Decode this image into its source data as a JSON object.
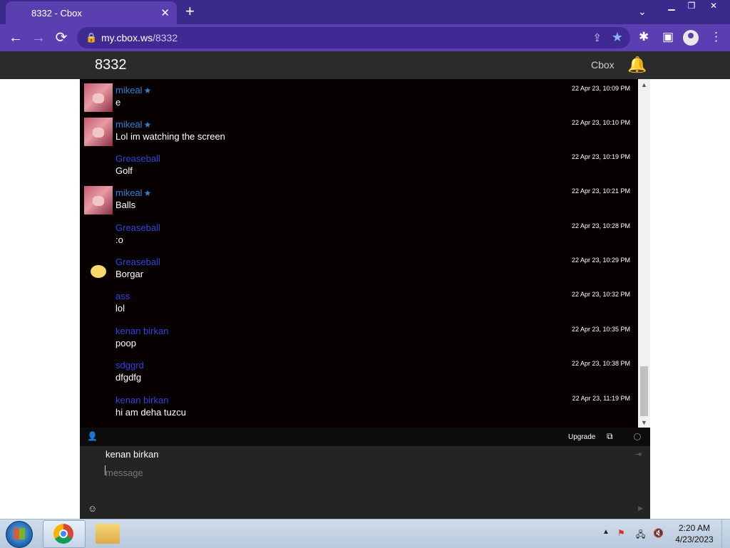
{
  "browser": {
    "tab_title": "8332 - Cbox",
    "tab_close": "✕",
    "new_tab": "+",
    "url_host": "my.cbox.ws",
    "url_path": "/8332"
  },
  "cbox": {
    "box_name": "8332",
    "brand": "Cbox",
    "messages": [
      {
        "user": "mikeal",
        "mod": true,
        "text": "e",
        "time": "22 Apr 23, 10:09 PM",
        "avatar": "anime-avatar"
      },
      {
        "user": "mikeal",
        "mod": true,
        "text": "Lol im watching the screen",
        "time": "22 Apr 23, 10:10 PM",
        "avatar": "anime-avatar"
      },
      {
        "user": "Greaseball",
        "mod": false,
        "text": "Golf",
        "time": "22 Apr 23, 10:19 PM",
        "avatar": ""
      },
      {
        "user": "mikeal",
        "mod": true,
        "text": "Balls",
        "time": "22 Apr 23, 10:21 PM",
        "avatar": "anime-avatar"
      },
      {
        "user": "Greaseball",
        "mod": false,
        "text": ":o",
        "time": "22 Apr 23, 10:28 PM",
        "avatar": ""
      },
      {
        "user": "Greaseball",
        "mod": false,
        "text": "Borgar",
        "time": "22 Apr 23, 10:29 PM",
        "avatar": "yellow-blob"
      },
      {
        "user": "ass",
        "mod": false,
        "text": "lol",
        "time": "22 Apr 23, 10:32 PM",
        "avatar": ""
      },
      {
        "user": "kenan birkan",
        "mod": false,
        "text": "poop",
        "time": "22 Apr 23, 10:35 PM",
        "avatar": ""
      },
      {
        "user": "sdggrd",
        "mod": false,
        "text": "dfgdfg",
        "time": "22 Apr 23, 10:38 PM",
        "avatar": ""
      },
      {
        "user": "kenan birkan",
        "mod": false,
        "text": "hi am deha tuzcu",
        "time": "22 Apr 23, 11:19 PM",
        "avatar": ""
      }
    ],
    "bar": {
      "upgrade": "Upgrade"
    },
    "form": {
      "nickname": "kenan birkan",
      "message_placeholder": "message",
      "message_value": ""
    }
  },
  "taskbar": {
    "time": "2:20 AM",
    "date": "4/23/2023"
  }
}
